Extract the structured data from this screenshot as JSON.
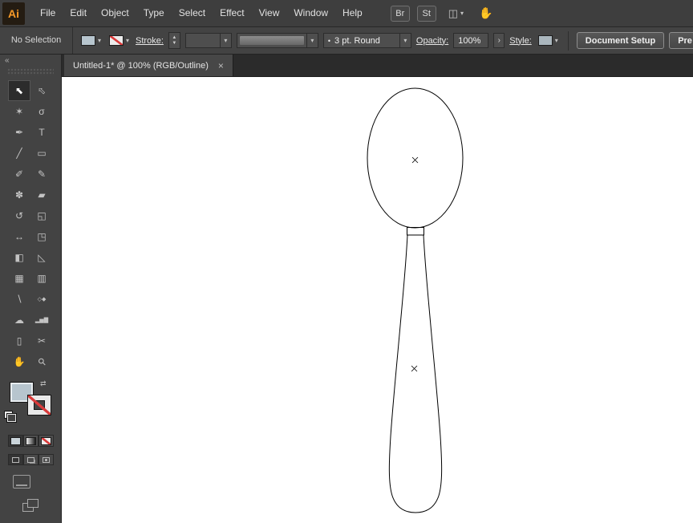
{
  "app": {
    "logo": "Ai"
  },
  "menubar": {
    "items": [
      "File",
      "Edit",
      "Object",
      "Type",
      "Select",
      "Effect",
      "View",
      "Window",
      "Help"
    ],
    "bridge": "Br",
    "stock": "St"
  },
  "controlbar": {
    "selection_status": "No Selection",
    "stroke_label": "Stroke:",
    "brush_name": "3 pt. Round",
    "opacity_label": "Opacity:",
    "opacity_value": "100%",
    "style_label": "Style:",
    "document_setup": "Document Setup",
    "preferences": "Pre",
    "fill_color": "#b7c5ce",
    "none_slash_color": "#d93a3a"
  },
  "tabbar": {
    "tab_title": "Untitled-1* @ 100% (RGB/Outline)"
  },
  "toolbar": {
    "tools": [
      {
        "name": "selection",
        "glyph": "⬉",
        "selected": true
      },
      {
        "name": "direct-selection",
        "glyph": "⬁"
      },
      {
        "name": "magic-wand",
        "glyph": "✶"
      },
      {
        "name": "lasso",
        "glyph": "σ"
      },
      {
        "name": "pen",
        "glyph": "✒"
      },
      {
        "name": "type",
        "glyph": "T"
      },
      {
        "name": "line-segment",
        "glyph": "╱"
      },
      {
        "name": "rectangle",
        "glyph": "▭"
      },
      {
        "name": "paintbrush",
        "glyph": "✐"
      },
      {
        "name": "pencil",
        "glyph": "✎"
      },
      {
        "name": "blob-brush",
        "glyph": "✽"
      },
      {
        "name": "eraser",
        "glyph": "▰"
      },
      {
        "name": "rotate",
        "glyph": "↺"
      },
      {
        "name": "scale",
        "glyph": "◱"
      },
      {
        "name": "width",
        "glyph": "↔"
      },
      {
        "name": "free-transform",
        "glyph": "◳"
      },
      {
        "name": "shape-builder",
        "glyph": "◧"
      },
      {
        "name": "perspective-grid",
        "glyph": "◺"
      },
      {
        "name": "mesh",
        "glyph": "▦"
      },
      {
        "name": "gradient",
        "glyph": "▥"
      },
      {
        "name": "eyedropper",
        "glyph": "∖"
      },
      {
        "name": "blend",
        "glyph": "◇◆"
      },
      {
        "name": "symbol-sprayer",
        "glyph": "☁"
      },
      {
        "name": "column-graph",
        "glyph": "▂▅▇"
      },
      {
        "name": "artboard",
        "glyph": "▯"
      },
      {
        "name": "slice",
        "glyph": "✂"
      },
      {
        "name": "hand",
        "glyph": "✋"
      },
      {
        "name": "zoom",
        "glyph": "⚲"
      }
    ]
  },
  "icons": {
    "chevron": "▾",
    "step_up": "▲",
    "step_down": "▼",
    "panel_arrow": "›",
    "swap": "⇄",
    "collapse": "«",
    "workspace": "◫",
    "touch": "✋",
    "brush_dot": "•",
    "close": "×"
  }
}
